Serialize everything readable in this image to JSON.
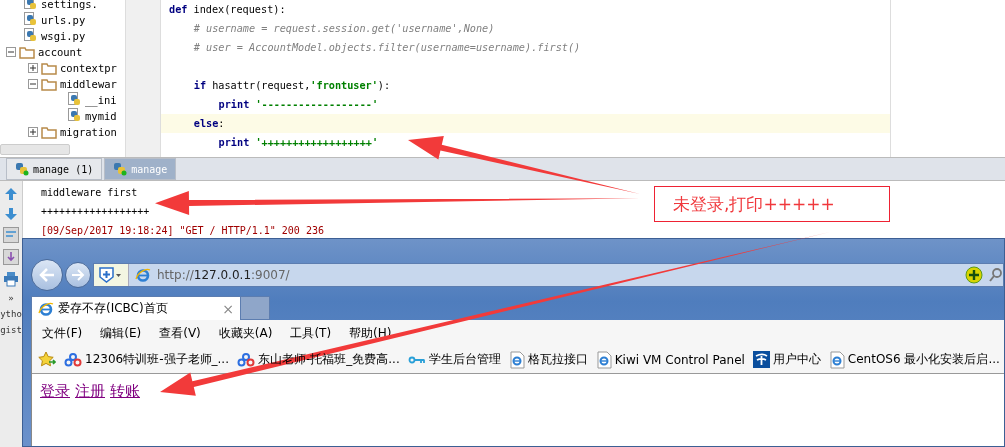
{
  "project_tree": [
    {
      "kind": "file",
      "label": "settings."
    },
    {
      "kind": "file",
      "label": "urls.py"
    },
    {
      "kind": "file",
      "label": "wsgi.py"
    },
    {
      "kind": "folder",
      "label": "account",
      "expanded": true,
      "children": [
        {
          "kind": "folder",
          "label": "contextpr",
          "expanded": false
        },
        {
          "kind": "folder",
          "label": "middlewar",
          "expanded": true,
          "children": [
            {
              "kind": "file",
              "label": "__ini"
            },
            {
              "kind": "file",
              "label": "mymid"
            }
          ]
        },
        {
          "kind": "folder",
          "label": "migration",
          "expanded": false
        }
      ]
    }
  ],
  "code_lines": [
    {
      "current": false,
      "tokens": [
        {
          "kind": "keyword",
          "text": "def"
        },
        {
          "kind": "plain",
          "text": " index(request):"
        }
      ],
      "children": [
        {
          "current": false,
          "tokens": [
            {
              "kind": "comment",
              "text": "# username = request.session.get('username',None)"
            }
          ]
        },
        {
          "current": false,
          "tokens": [
            {
              "kind": "comment",
              "text": "# user = AccountModel.objects.filter(username=username).first()"
            }
          ]
        },
        {
          "current": false
        },
        {
          "current": false,
          "tokens": [
            {
              "kind": "keyword",
              "text": "if"
            },
            {
              "kind": "plain",
              "text": " hasattr(request,"
            },
            {
              "kind": "string",
              "text": "'frontuser'"
            },
            {
              "kind": "plain",
              "text": "):"
            }
          ],
          "children": [
            {
              "current": false,
              "tokens": [
                {
                  "kind": "keyword",
                  "text": "print"
                },
                {
                  "kind": "string",
                  "text": " '------------------'"
                }
              ]
            }
          ]
        },
        {
          "current": true,
          "tokens": [
            {
              "kind": "keyword",
              "text": "else"
            },
            {
              "kind": "plain",
              "text": ":"
            }
          ],
          "children": [
            {
              "current": false,
              "tokens": [
                {
                  "kind": "keyword",
                  "text": "print"
                },
                {
                  "kind": "string",
                  "text": " '++++++++++++++++++'"
                }
              ]
            }
          ]
        }
      ]
    }
  ],
  "run_tabs": [
    {
      "label": "manage (1)",
      "selected": false
    },
    {
      "label": "manage",
      "selected": true
    }
  ],
  "console_lines": [
    {
      "kind": "stdout",
      "text": "middleware first"
    },
    {
      "kind": "stdout",
      "text": "++++++++++++++++++"
    },
    {
      "kind": "stderr",
      "text": "[09/Sep/2017 19:18:24] \"GET / HTTP/1.1\" 200 236"
    }
  ],
  "side_panel_texts": [
    {
      "text": "»"
    },
    {
      "text": "ytho"
    },
    {
      "text": "gist"
    }
  ],
  "browser": {
    "address": {
      "scheme": "http://",
      "host": "127.0.0.1",
      "rest": ":9007/"
    },
    "tab": {
      "title": "爱存不存(ICBC)首页",
      "close": "×"
    },
    "menu": [
      "文件(F)",
      "编辑(E)",
      "查看(V)",
      "收藏夹(A)",
      "工具(T)",
      "帮助(H)"
    ],
    "favorites": [
      {
        "kind": "cloud",
        "label": "12306特训班-强子老师_..."
      },
      {
        "kind": "cloud",
        "label": "东山老师-托福班_免费高..."
      },
      {
        "kind": "key",
        "label": "学生后台管理"
      },
      {
        "kind": "page",
        "label": "格瓦拉接口"
      },
      {
        "kind": "page",
        "label": "Kiwi VM Control Panel"
      },
      {
        "kind": "telecom",
        "label": "用户中心"
      },
      {
        "kind": "page",
        "label": "CentOS6 最小化安装后启..."
      }
    ],
    "links": [
      "登录",
      "注册",
      "转账"
    ]
  },
  "callout": {
    "text": "未登录,打印+++++"
  }
}
